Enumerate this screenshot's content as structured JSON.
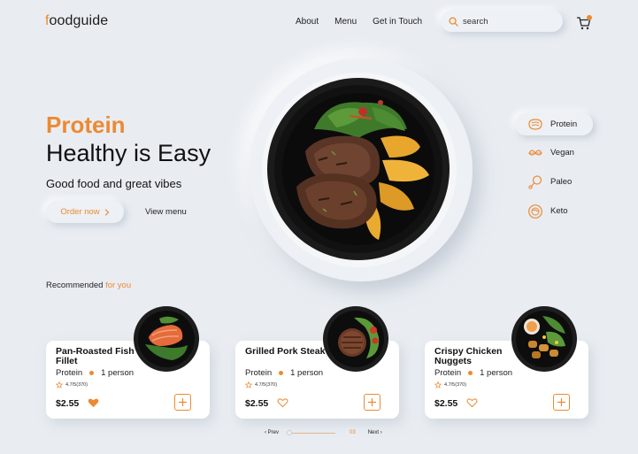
{
  "header": {
    "logo_accent": "f",
    "logo_rest": "oodguide",
    "nav": [
      "About",
      "Menu",
      "Get in Touch"
    ],
    "search_placeholder": "search",
    "cart_icon": "cart-icon",
    "brand_color": "#ec8a32"
  },
  "hero": {
    "title": "Protein",
    "subtitle": "Healthy is Easy",
    "tagline": "Good food and great vibes",
    "order_button": "Order now",
    "view_menu": "View menu"
  },
  "diets": [
    {
      "label": "Protein",
      "icon": "steak-icon",
      "active": true
    },
    {
      "label": "Vegan",
      "icon": "leaf-icon",
      "active": false
    },
    {
      "label": "Paleo",
      "icon": "drumstick-icon",
      "active": false
    },
    {
      "label": "Keto",
      "icon": "keto-plate-icon",
      "active": false
    }
  ],
  "recommended": {
    "title_main": "Recommended",
    "title_accent": "for you"
  },
  "cards": [
    {
      "name": "Pan-Roasted Fish Fillet",
      "category": "Protein",
      "serves": "1 person",
      "rating": "4.7/5(370)",
      "price": "$2.55",
      "liked": true
    },
    {
      "name": "Grilled Pork Steak",
      "category": "Protein",
      "serves": "1 person",
      "rating": "4.7/5(370)",
      "price": "$2.55",
      "liked": false
    },
    {
      "name": "Crispy Chicken Nuggets",
      "category": "Protein",
      "serves": "1 person",
      "rating": "4.7/5(370)",
      "price": "$2.55",
      "liked": false
    }
  ],
  "pager": {
    "prev": "Prev",
    "page": "03",
    "next": "Next"
  }
}
